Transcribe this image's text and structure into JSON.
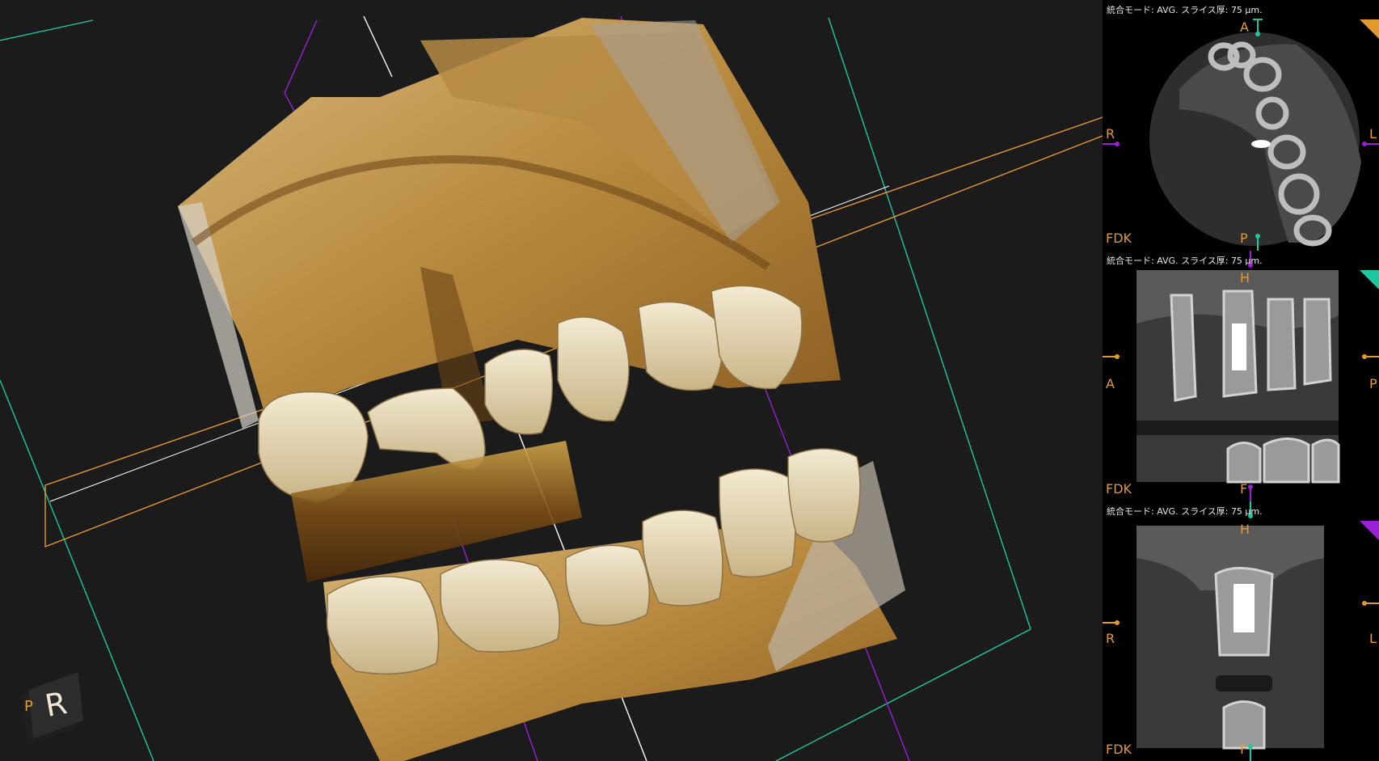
{
  "viewport3d": {
    "orientation_cube": {
      "face_letter": "R",
      "side_letter": "P"
    }
  },
  "panels": [
    {
      "header": "統合モード: AVG. スライス厚: 75 μm.",
      "top": "A",
      "bottom": "P",
      "left": "R",
      "right": "L",
      "corner_text": "FDK",
      "corner_color": "#e39a2d"
    },
    {
      "header": "統合モード: AVG. スライス厚: 75 μm.",
      "top": "H",
      "bottom": "F",
      "left": "A",
      "right": "P",
      "corner_text": "FDK",
      "corner_color": "#1fc7a0"
    },
    {
      "header": "統合モード: AVG. スライス厚: 75 μm.",
      "top": "H",
      "bottom": "F",
      "left": "R",
      "right": "L",
      "corner_text": "FDK",
      "corner_color": "#9b1fd6"
    }
  ],
  "colors": {
    "orange": "#e39a2d",
    "teal": "#1fc7a0",
    "purple": "#9b1fd6",
    "bone": "#c9a35a"
  }
}
